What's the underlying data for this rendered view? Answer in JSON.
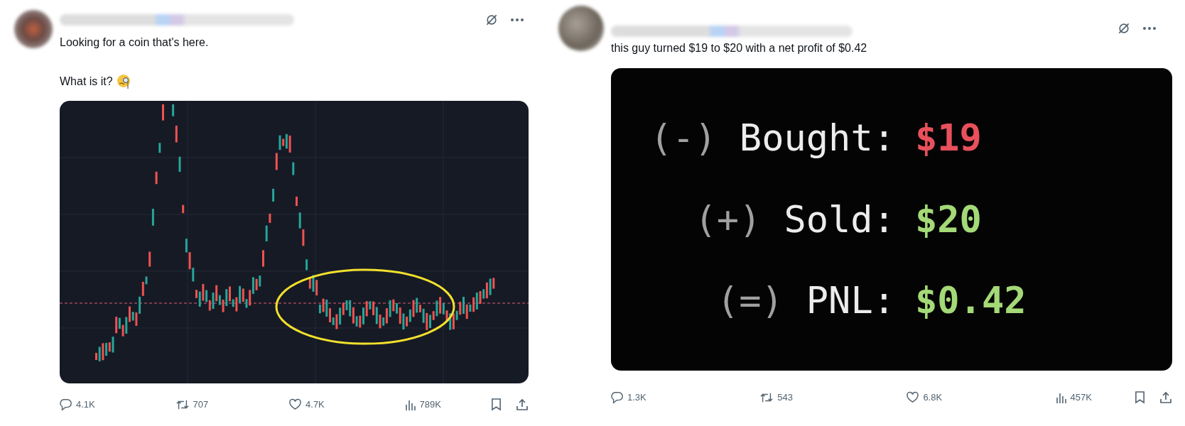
{
  "posts": [
    {
      "text_lines": [
        "Looking for a coin that's here.",
        "What is it?"
      ],
      "media": {
        "kind": "chart"
      },
      "stats": {
        "replies": "4.1K",
        "reposts": "707",
        "likes": "4.7K",
        "views": "789K"
      }
    },
    {
      "text_lines": [
        "this guy turned $19 to $20 with a net profit of $0.42"
      ],
      "media": {
        "kind": "receipt",
        "lines": [
          {
            "sign": "(-)",
            "label": "Bought:",
            "value": "$19",
            "color": "#e8505b"
          },
          {
            "sign": "(+)",
            "label": "Sold:",
            "value": "$20",
            "color": "#a3d977"
          },
          {
            "sign": "(=)",
            "label": "PNL:",
            "value": "$0.42",
            "color": "#a3d977"
          }
        ]
      },
      "stats": {
        "replies": "1.3K",
        "reposts": "543",
        "likes": "6.8K",
        "views": "457K"
      }
    }
  ]
}
